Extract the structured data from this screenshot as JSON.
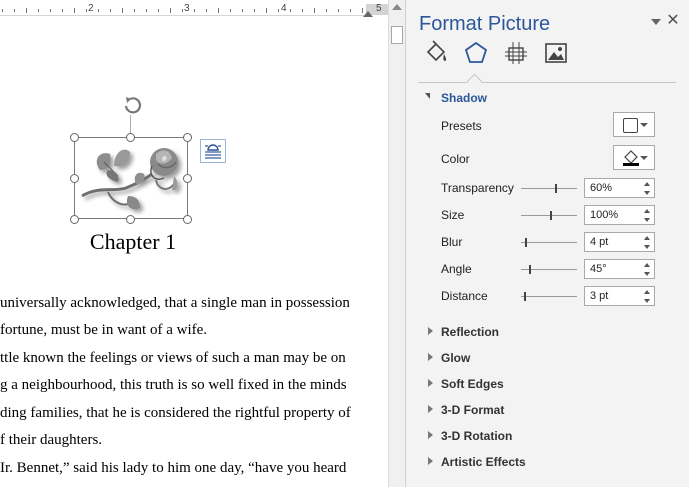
{
  "ruler": {
    "marks": [
      "2",
      "3",
      "4",
      "5"
    ]
  },
  "document": {
    "chapter_title": "Chapter 1",
    "lines": [
      "universally acknowledged, that a single man in possession",
      "fortune, must be in want of a wife.",
      "ttle known the feelings or views of such a man may be on",
      "g a neighbourhood, this truth is so well fixed in the minds",
      "ding families, that he is considered the rightful property of",
      "f their daughters.",
      "Ir. Bennet,” said his lady to him one day, “have you heard"
    ]
  },
  "pane": {
    "title": "Format Picture",
    "categories": [
      "fill-line-icon",
      "effects-icon",
      "size-properties-icon",
      "picture-icon"
    ],
    "section": "Shadow",
    "presets_label": "Presets",
    "color_label": "Color",
    "color_value": "#000000",
    "properties": [
      {
        "label": "Transparency",
        "value": "60%",
        "level": 0.6
      },
      {
        "label": "Size",
        "value": "100%",
        "level": 0.5
      },
      {
        "label": "Blur",
        "value": "4 pt",
        "level": 0.04
      },
      {
        "label": "Angle",
        "value": "45°",
        "level": 0.12
      },
      {
        "label": "Distance",
        "value": "3 pt",
        "level": 0.02
      }
    ],
    "collapsed_sections": [
      "Reflection",
      "Glow",
      "Soft Edges",
      "3-D Format",
      "3-D Rotation",
      "Artistic Effects"
    ]
  },
  "colors": {
    "accent": "#2b579a",
    "pane_bg": "#f3f3f3"
  }
}
